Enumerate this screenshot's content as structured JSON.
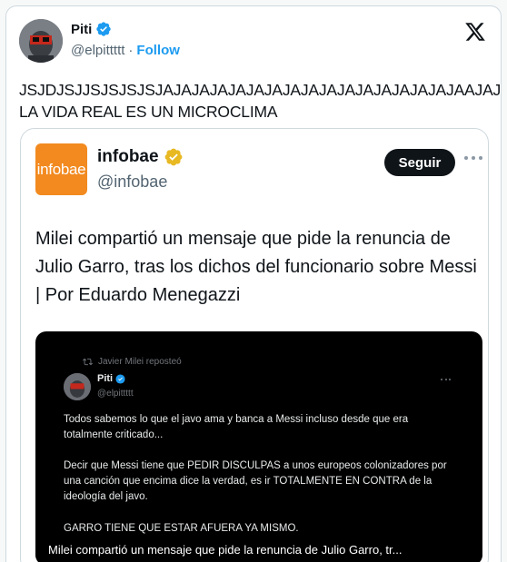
{
  "tweet": {
    "author_name": "Piti",
    "handle": "@elpittttt",
    "separator": "·",
    "follow_label": "Follow",
    "text": "JSJDJSJJSJSJSJSJAJAJAJAJAJAJAJAJAJAJAJAJAJAJAJAJAAJAJA\nLA VIDA REAL ES UN MICROCLIMA"
  },
  "quoted_card": {
    "logo_text": "infobae",
    "name": "infobae",
    "handle": "@infobae",
    "follow_label": "Seguir",
    "headline": "Milei compartió un mensaje que pide la renuncia de Julio Garro, tras los dichos del funcionario sobre Messi | Por Eduardo Menegazzi"
  },
  "embedded_screenshot": {
    "reposted_by": "Javier Milei reposteó",
    "author_name": "Piti",
    "handle": "@elpittttt",
    "paragraph_1": "Todos sabemos lo que el javo ama y banca a Messi incluso desde que era totalmente criticado...",
    "paragraph_2": "Decir que Messi tiene que PEDIR DISCULPAS a unos europeos colonizadores por una canción que encima dice la verdad, es ir TOTALMENTE EN CONTRA de la ideología del javo.",
    "paragraph_3": "GARRO TIENE QUE ESTAR AFUERA YA MISMO.",
    "caption": "Milei compartió un mensaje que pide la renuncia de Julio Garro, tr..."
  },
  "colors": {
    "accent": "#1d9bf0",
    "infobae_orange": "#f28a1f",
    "gold_badge": "#e8b923",
    "text": "#0f1419",
    "secondary": "#536471"
  },
  "icons": {
    "platform": "x-logo-icon",
    "verified": "verified-badge-icon",
    "org_verified": "gold-verified-badge-icon",
    "retweet": "repost-icon",
    "more": "more-options-icon"
  }
}
